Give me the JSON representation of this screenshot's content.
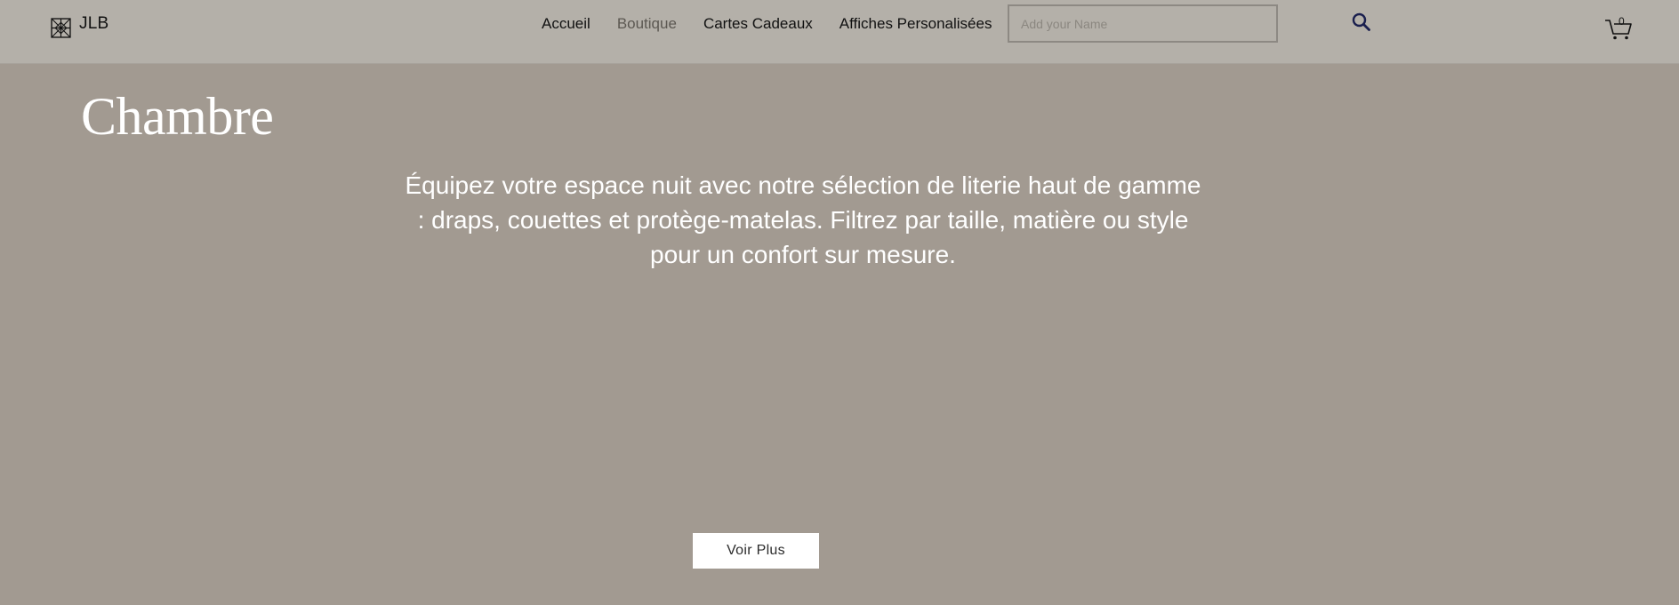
{
  "header": {
    "logo_text": "JLB",
    "nav": [
      {
        "label": "Accueil"
      },
      {
        "label": "Boutique"
      },
      {
        "label": "Cartes Cadeaux"
      },
      {
        "label": "Affiches Personalisées"
      }
    ],
    "name_input": {
      "placeholder": "Add your Name",
      "value": ""
    },
    "search_icon": "search-icon",
    "cart": {
      "icon": "cart-icon",
      "count": "0"
    }
  },
  "main": {
    "title": "Chambre",
    "description": "Équipez votre espace nuit avec notre sélection de literie haut de gamme : draps, couettes et protège-matelas. Filtrez par taille, matière ou style pour un confort sur mesure.",
    "button_label": "Voir Plus"
  },
  "colors": {
    "header_bg": "#b4b0a9",
    "page_bg": "#a29a91",
    "search_icon": "#1a1f4e"
  }
}
